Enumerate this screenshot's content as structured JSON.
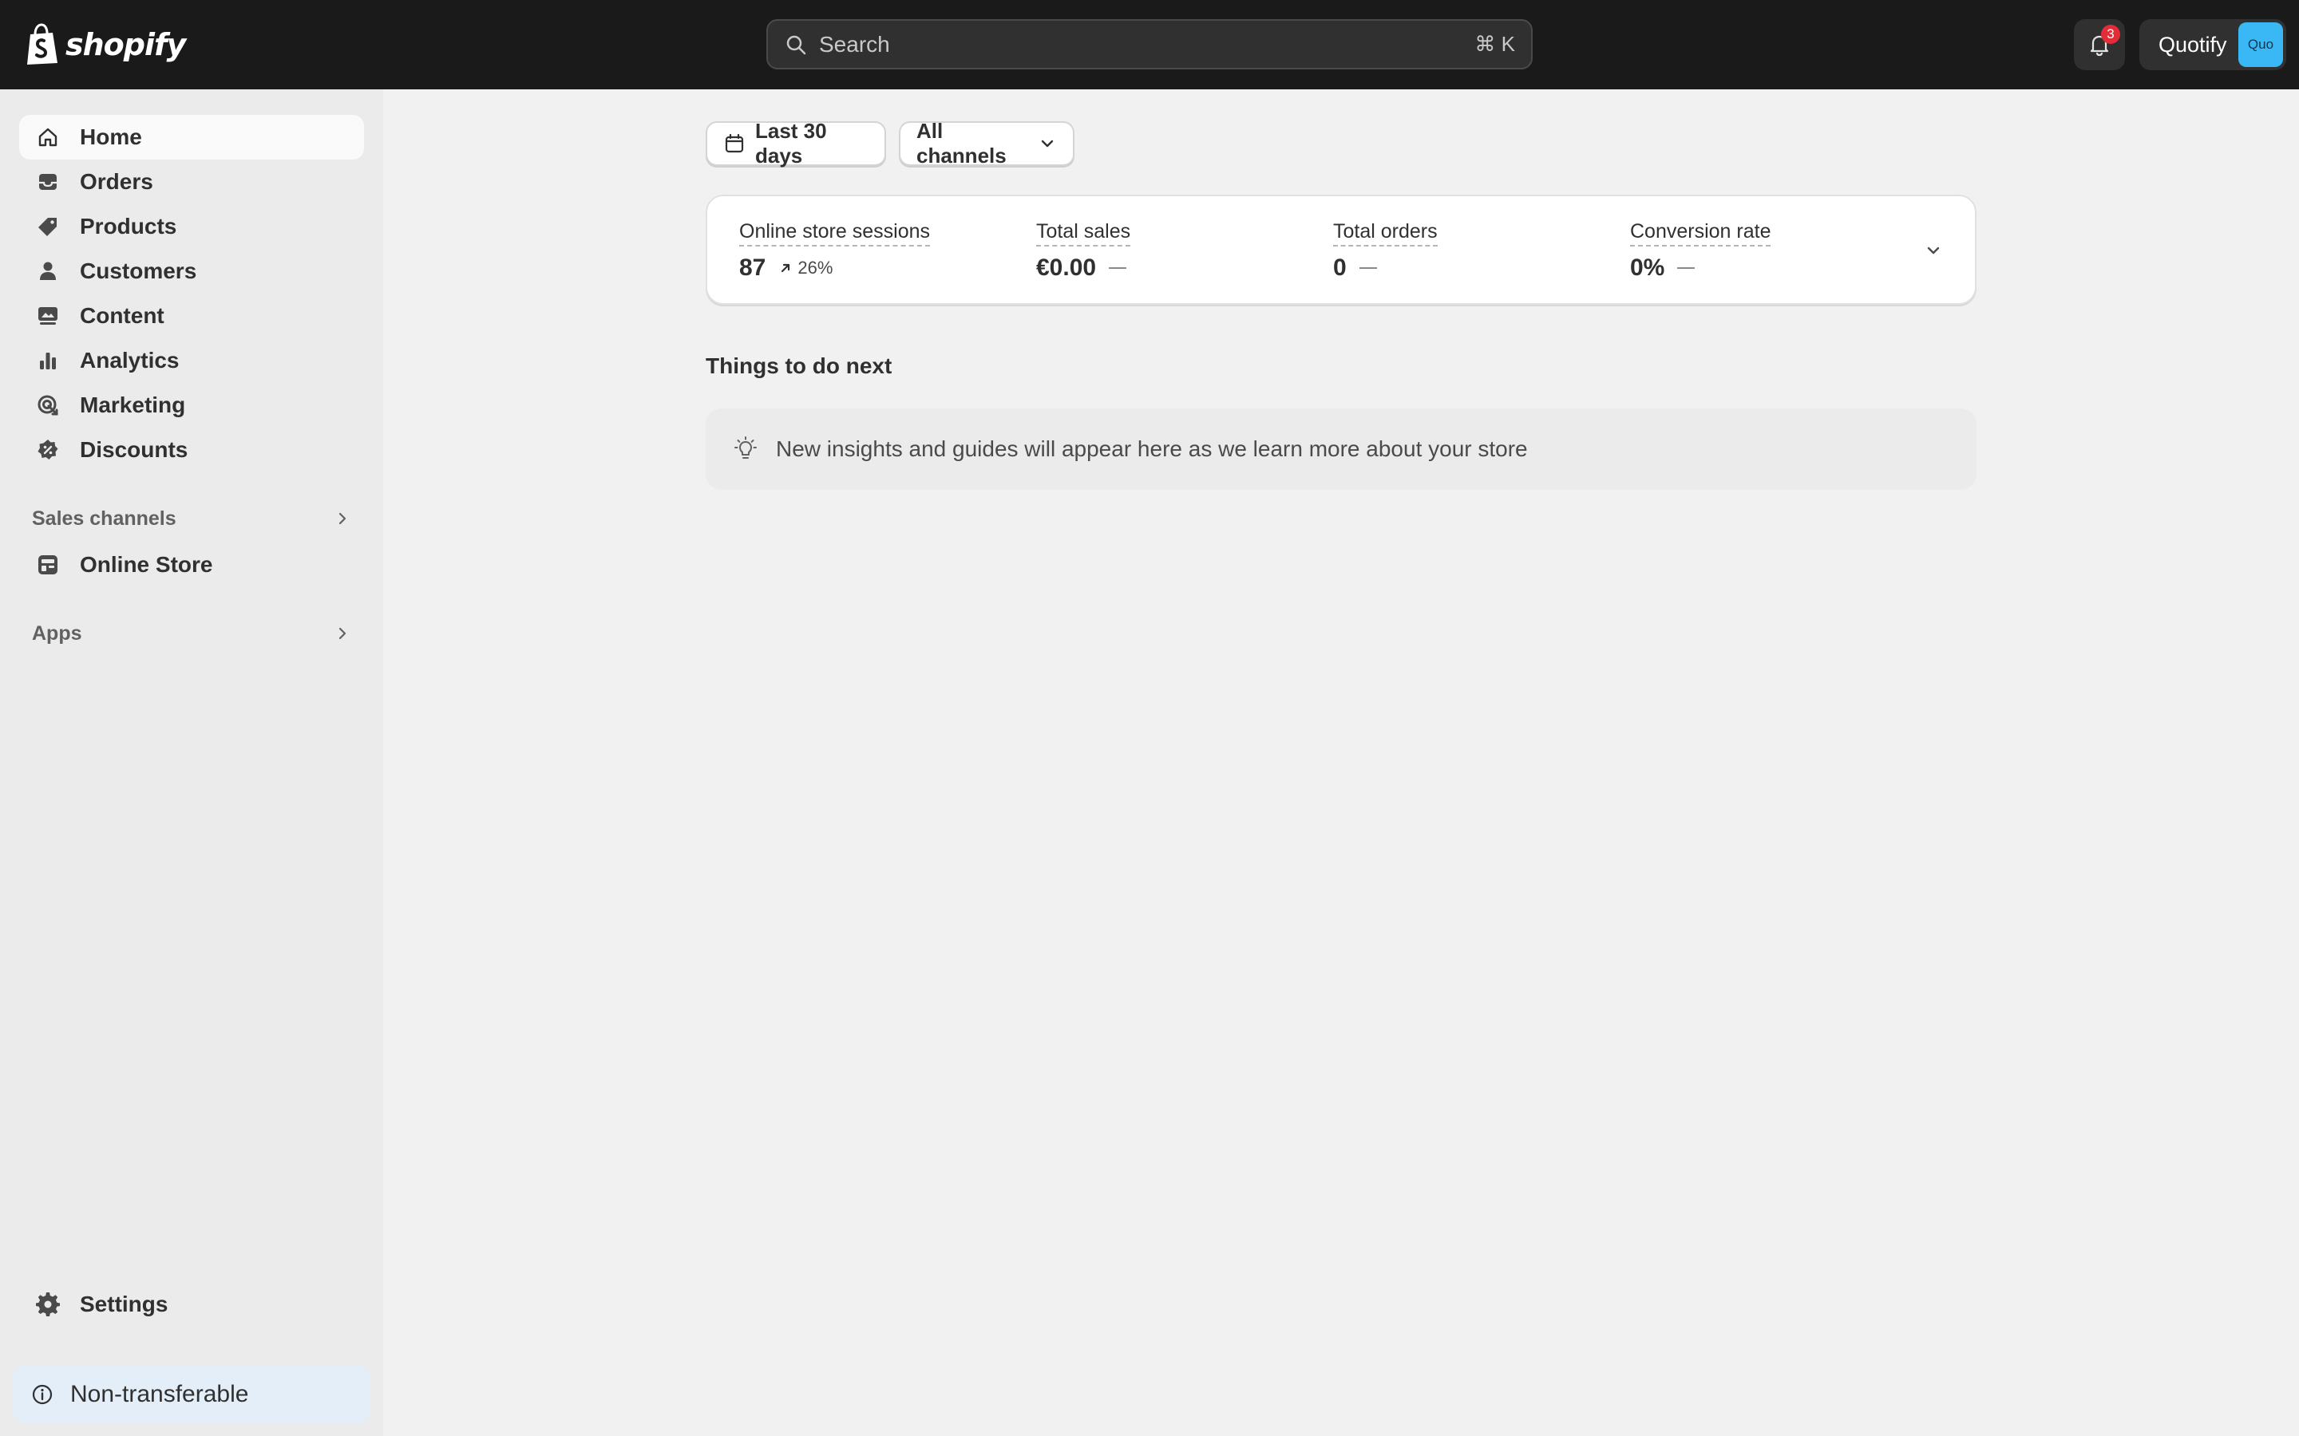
{
  "brand": {
    "wordmark": "shopify",
    "logo_icon": "shopify-bag-icon"
  },
  "search": {
    "placeholder": "Search",
    "shortcut": "⌘ K"
  },
  "notifications": {
    "count": "3"
  },
  "store": {
    "name": "Quotify",
    "avatar_text": "Quo",
    "avatar_color": "#3ab8f5"
  },
  "sidebar": {
    "items": [
      {
        "label": "Home",
        "icon": "home-icon",
        "active": true
      },
      {
        "label": "Orders",
        "icon": "inbox-icon"
      },
      {
        "label": "Products",
        "icon": "tag-icon"
      },
      {
        "label": "Customers",
        "icon": "person-icon"
      },
      {
        "label": "Content",
        "icon": "content-icon"
      },
      {
        "label": "Analytics",
        "icon": "bar-chart-icon"
      },
      {
        "label": "Marketing",
        "icon": "target-icon"
      },
      {
        "label": "Discounts",
        "icon": "discount-icon"
      }
    ],
    "sales_channels": {
      "label": "Sales channels",
      "items": [
        {
          "label": "Online Store",
          "icon": "store-icon"
        }
      ]
    },
    "apps": {
      "label": "Apps"
    },
    "settings": {
      "label": "Settings",
      "icon": "gear-icon"
    },
    "plan_notice": {
      "label": "Non-transferable",
      "icon": "info-icon",
      "bg": "#e3eef9"
    }
  },
  "filters": {
    "date_range": "Last 30 days",
    "channels": "All channels"
  },
  "metrics": [
    {
      "label": "Online store sessions",
      "value": "87",
      "change": "26%",
      "trend": "up"
    },
    {
      "label": "Total sales",
      "value": "€0.00",
      "change": null
    },
    {
      "label": "Total orders",
      "value": "0",
      "change": null
    },
    {
      "label": "Conversion rate",
      "value": "0%",
      "change": null
    }
  ],
  "next": {
    "title": "Things to do next",
    "insight": "New insights and guides will appear here as we learn more about your store",
    "icon": "lightbulb-icon"
  },
  "colors": {
    "topbar": "#1a1a1a",
    "sidebar": "#ebebeb",
    "background": "#f1f1f1",
    "badge": "#e22c38"
  }
}
